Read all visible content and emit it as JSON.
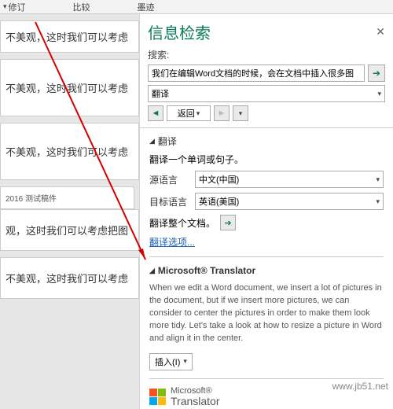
{
  "ribbon": {
    "revise": "修订",
    "compare": "比较",
    "ink": "墨迹"
  },
  "doc": {
    "line1": "不美观，这时我们可以考虑",
    "line2": "不美观，这时我们可以考虑",
    "line3": "不美观，这时我们可以考虑",
    "label2016": "2016 测试稿件",
    "line4": "观，这时我们可以考虑把图",
    "line5": "不美观，这时我们可以考虑"
  },
  "pane": {
    "title": "信息检索",
    "search_label": "搜索:",
    "search_value": "我们在编辑Word文档的时候，会在文档中插入很多图",
    "source_select": "翻译",
    "back": "返回",
    "sect_translate": "翻译",
    "translate_tip": "翻译一个单词或句子。",
    "src_lang_label": "源语言",
    "src_lang_value": "中文(中国)",
    "tgt_lang_label": "目标语言",
    "tgt_lang_value": "英语(美国)",
    "whole_doc": "翻译整个文档。",
    "options_link": "翻译选项...",
    "translator_hdr": "Microsoft® Translator",
    "translator_body": "When we edit a Word document, we insert a lot of pictures in the document, but if we insert more pictures, we can consider to center the pictures in order to make them look more tidy. Let's take a look at how to resize a picture in Word and align it in the center.",
    "insert_label": "插入(I)",
    "logo_top": "Microsoft®",
    "logo_bottom": "Translator"
  },
  "watermark": "www.jb51.net"
}
